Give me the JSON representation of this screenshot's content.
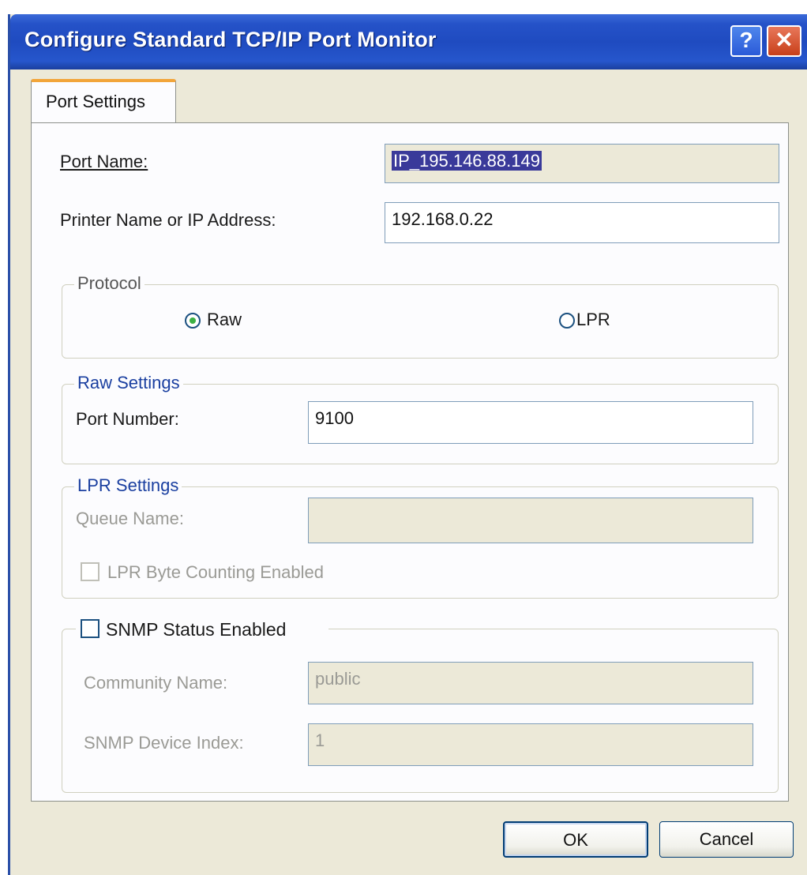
{
  "window": {
    "title": "Configure Standard TCP/IP Port Monitor",
    "help_icon": "?",
    "close_icon": "✕"
  },
  "tabs": [
    {
      "label": "Port Settings",
      "active": true
    }
  ],
  "port_name": {
    "label": "Port Name:",
    "value": "IP_195.146.88.149"
  },
  "printer_address": {
    "label": "Printer Name or IP Address:",
    "value": "192.168.0.22"
  },
  "protocol": {
    "title": "Protocol",
    "options": [
      {
        "label": "Raw",
        "selected": true
      },
      {
        "label": "LPR",
        "selected": false
      }
    ]
  },
  "raw_settings": {
    "title": "Raw Settings",
    "port_number_label": "Port Number:",
    "port_number_value": "9100"
  },
  "lpr_settings": {
    "title": "LPR Settings",
    "queue_name_label": "Queue Name:",
    "queue_name_value": "",
    "byte_counting_label": "LPR Byte Counting Enabled",
    "byte_counting_checked": false
  },
  "snmp": {
    "checkbox_label": "SNMP Status Enabled",
    "checked": false,
    "community_label": "Community Name:",
    "community_value": "public",
    "device_index_label": "SNMP Device Index:",
    "device_index_value": "1"
  },
  "buttons": {
    "ok": "OK",
    "cancel": "Cancel"
  },
  "colors": {
    "titlebar": "#2552c8",
    "dialog_bg": "#ece9d8",
    "selection": "#3a3a9a",
    "radio_dot": "#3cb043"
  }
}
